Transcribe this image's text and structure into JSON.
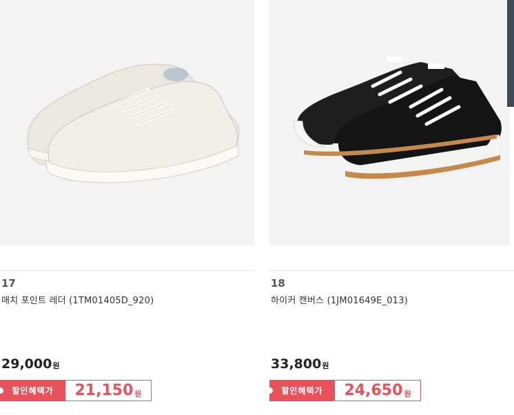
{
  "products": [
    {
      "rank": "17",
      "name": "매치 포인트 레더 (1TM01405D_920)",
      "price": "29,000",
      "price_unit": "원",
      "sale_label": "할인혜택가",
      "sale_price": "21,150",
      "sale_unit": "원",
      "image": "white-leather-sneaker"
    },
    {
      "rank": "18",
      "name": "하이커 캔버스 (1JM01649E_013)",
      "price": "33,800",
      "price_unit": "원",
      "sale_label": "할인혜택가",
      "sale_price": "24,650",
      "sale_unit": "원",
      "image": "black-canvas-sneaker"
    }
  ],
  "colors": {
    "accent": "#e8525a",
    "image_bg": "#f3f3f3"
  }
}
